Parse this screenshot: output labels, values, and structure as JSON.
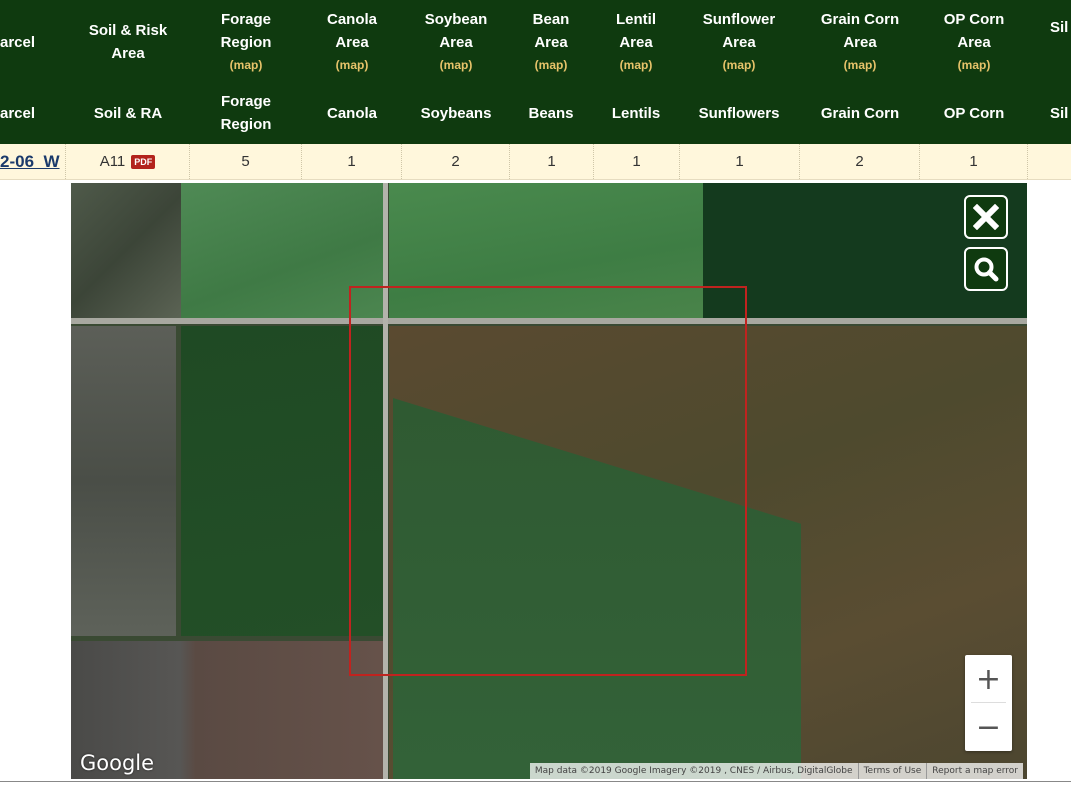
{
  "header": {
    "row1": [
      {
        "label": "arcel",
        "map": ""
      },
      {
        "label": "Soil & Risk Area",
        "map": ""
      },
      {
        "label": "Forage Region",
        "map": "(map)"
      },
      {
        "label": "Canola Area",
        "map": "(map)"
      },
      {
        "label": "Soybean Area",
        "map": "(map)"
      },
      {
        "label": "Bean Area",
        "map": "(map)"
      },
      {
        "label": "Lentil Area",
        "map": "(map)"
      },
      {
        "label": "Sunflower Area",
        "map": "(map)"
      },
      {
        "label": "Grain Corn Area",
        "map": "(map)"
      },
      {
        "label": "OP Corn Area",
        "map": "(map)"
      },
      {
        "label": "Sil",
        "map": ""
      }
    ],
    "row2": [
      "arcel",
      "Soil & RA",
      "Forage Region",
      "Canola",
      "Soybeans",
      "Beans",
      "Lentils",
      "Sunflowers",
      "Grain Corn",
      "OP Corn",
      "Sil"
    ]
  },
  "row": {
    "parcel": "2-06  W",
    "soil_ra": "A11",
    "pdf_badge": "PDF",
    "values": [
      "5",
      "1",
      "2",
      "1",
      "1",
      "1",
      "2",
      "1"
    ]
  },
  "map": {
    "close_icon": "close-icon",
    "search_icon": "magnifier-icon",
    "zoom_in": "+",
    "zoom_out": "−",
    "logo": "Google",
    "attribution": [
      "Map data ©2019 Google Imagery ©2019 , CNES / Airbus, DigitalGlobe",
      "Terms of Use",
      "Report a map error"
    ],
    "bbox_color": "#c0231f"
  },
  "colors": {
    "header_bg": "#0f3a0f",
    "map_link": "#e7c36a",
    "row_bg": "#fff7dc"
  }
}
